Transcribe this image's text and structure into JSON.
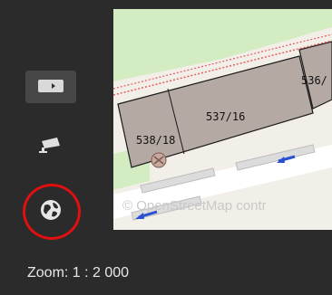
{
  "map": {
    "parcels": [
      "538/18",
      "537/16",
      "536/"
    ],
    "attribution": "© OpenStreetMap contr"
  },
  "toolbar": {
    "items": [
      {
        "name": "layer-toggle",
        "icon": "label-arrow-icon"
      },
      {
        "name": "camera",
        "icon": "camera-icon"
      },
      {
        "name": "globe",
        "icon": "globe-icon",
        "highlighted": true
      }
    ]
  },
  "status": {
    "zoom": "Zoom: 1 : 2 000"
  },
  "colors": {
    "background": "#2b2b2b",
    "highlight": "#e01010",
    "parcel_fill": "#b5a9a4",
    "map_base": "#f2efe9",
    "green": "#d4ecc1"
  }
}
